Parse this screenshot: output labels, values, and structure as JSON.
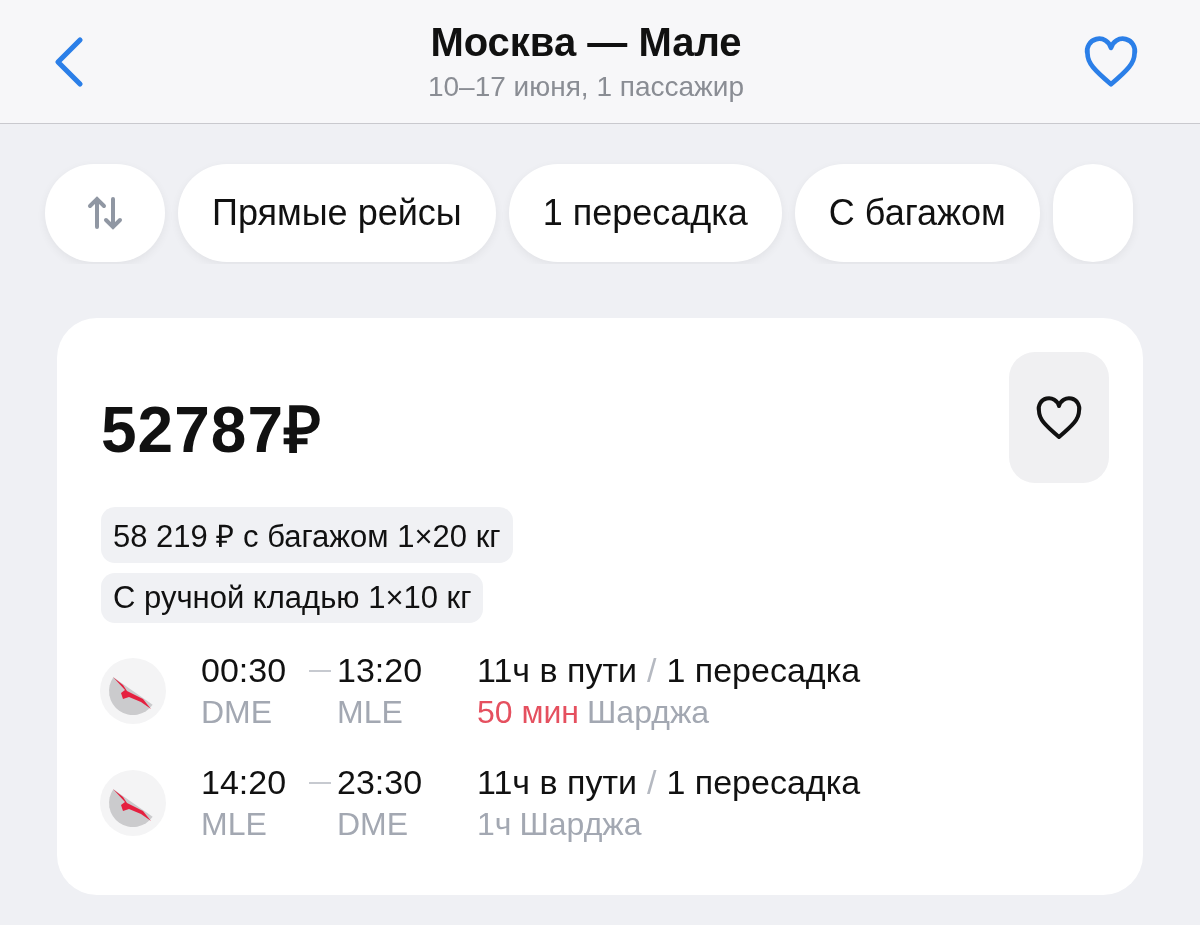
{
  "header": {
    "title": "Москва — Мале",
    "subtitle": "10–17 июня, 1 пассажир",
    "favorite": false
  },
  "filters": [
    {
      "kind": "sort"
    },
    {
      "kind": "chip",
      "label": "Прямые рейсы",
      "selected": false
    },
    {
      "kind": "chip",
      "label": "1 пересадка",
      "selected": false
    },
    {
      "kind": "chip",
      "label": "С багажом",
      "selected": false
    },
    {
      "kind": "chip",
      "selected": false
    }
  ],
  "offer": {
    "price": "52787",
    "currency": "₽",
    "favorite": false,
    "tags": [
      "58 219 ₽ с багажом 1×20 кг",
      "С ручной кладью 1×10 кг"
    ],
    "legs": [
      {
        "depart_time": "00:30",
        "arrive_time": "13:20",
        "depart_code": "DME",
        "arrive_code": "MLE",
        "duration": "11ч в пути",
        "separator": "/",
        "stops": "1 пересадка",
        "layover": "50 мин",
        "layover_warning": true,
        "layover_city": "Шарджа"
      },
      {
        "depart_time": "14:20",
        "arrive_time": "23:30",
        "depart_code": "MLE",
        "arrive_code": "DME",
        "duration": "11ч в пути",
        "separator": "/",
        "stops": "1 пересадка",
        "layover": "1ч",
        "layover_warning": false,
        "layover_city": "Шарджа"
      }
    ]
  }
}
